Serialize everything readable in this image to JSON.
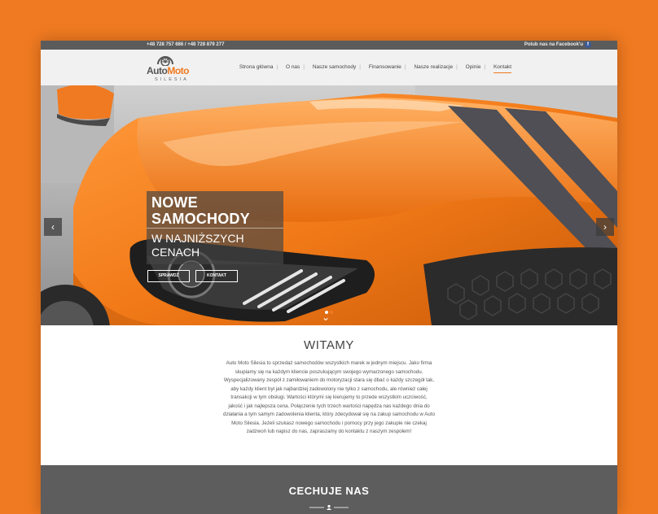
{
  "topbar": {
    "phones": "+48 728 757 686 / +48 728 879 277",
    "facebook_label": "Polub nas na Facebook'u",
    "facebook_icon": "f"
  },
  "logo": {
    "auto": "Auto",
    "moto": "Moto",
    "sub": "SILESIA"
  },
  "nav": {
    "items": [
      "Strona główna",
      "O nas",
      "Nasze samochody",
      "Finansowanie",
      "Nasze realizacje",
      "Opinie",
      "Kontakt"
    ],
    "active": "Kontakt"
  },
  "hero": {
    "title": "NOWE SAMOCHODY",
    "title_line1": "NOWE",
    "title_line2": "SAMOCHODY",
    "subtitle_line1": "W NAJNIŻSZYCH",
    "subtitle_line2": "CENACH",
    "button1": "SPRAWDŹ",
    "button2": "KONTAKT",
    "prev": "‹",
    "next": "›",
    "scroll": "⌄"
  },
  "welcome": {
    "heading": "WITAMY",
    "text": "Auto Moto Silesia to sprzedaż samochodów wszystkich marek w jednym miejscu. Jako firma skupiamy się na każdym kliencie poszukującym swojego wymarzonego samochodu. Wyspecjalizowany zespół z zamiłowaniem do motoryzacji stara się dbać o każdy szczegół tak, aby każdy klient był jak najbardziej zadowolony nie tylko z samochodu, ale również całej transakcji w tym obsługi. Wartości którymi się kierujemy to przede wszystkim uczciwość, jakość i jak najlepsza cena. Połączenie tych trzech wartości napędza nas każdego dnia do działania a tym samym zadowolenia klienta, który zdecydował się na zakup samochodu w Auto Moto Silesia. Jeżeli szukasz nowego samochodu i pomocy przy jego zakupie nie czekaj zadzwoń lub napisz do nas, zapraszamy do kontaktu z naszym zespołem!"
  },
  "features": {
    "heading": "CECHUJE NAS"
  },
  "colors": {
    "accent": "#f07a21",
    "dark": "#5b5b5b"
  }
}
